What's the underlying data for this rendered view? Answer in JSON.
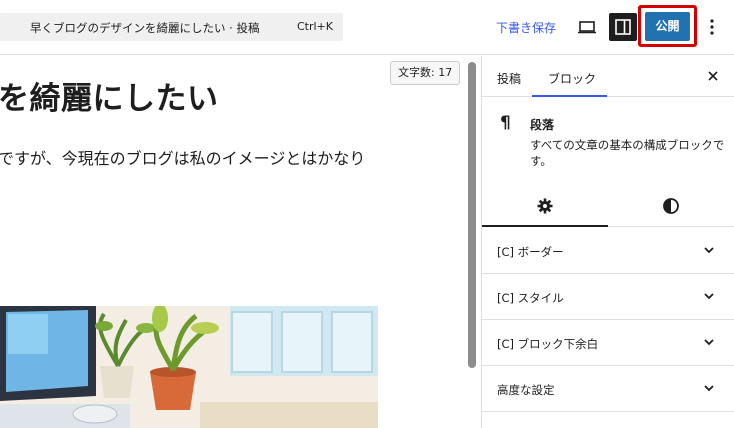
{
  "header": {
    "command_text": "早くブログのデザインを綺麗にしたい · 投稿",
    "shortcut": "Ctrl+K",
    "save_draft": "下書き保存",
    "publish": "公開",
    "icons": [
      "desktop-icon",
      "sidebar-toggle-icon",
      "more-vertical-icon"
    ]
  },
  "editor": {
    "word_count": "文字数: 17",
    "title_visible": "を綺麗にしたい",
    "paragraph_visible": "ですが、今現在のブログは私のイメージとはかなり"
  },
  "sidebar": {
    "tabs": [
      "投稿",
      "ブロック"
    ],
    "active_tab": "ブロック",
    "block": {
      "icon": "¶",
      "name": "段落",
      "description": "すべての文章の基本の構成ブロックです。"
    },
    "settings_tabs": [
      "gear-icon",
      "contrast-icon"
    ],
    "sections": [
      "[C] ボーダー",
      "[C] スタイル",
      "[C] ブロック下余白",
      "高度な設定"
    ]
  },
  "colors": {
    "accent": "#3858e9",
    "publish": "#2271b1",
    "highlight": "#d40000"
  }
}
